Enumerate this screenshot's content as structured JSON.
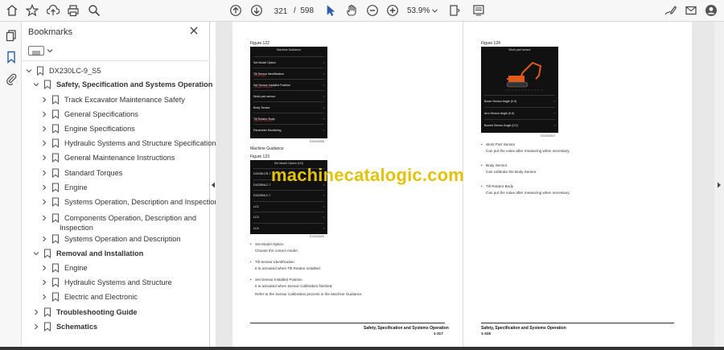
{
  "toolbar": {
    "page_current": "321",
    "page_separator": "/",
    "page_total": "598",
    "zoom": "53.9%",
    "icons": [
      "home-icon",
      "star-icon",
      "upload-icon",
      "print-icon",
      "zoom-search-icon",
      "page-up-icon",
      "page-down-icon",
      "select-cursor-icon",
      "hand-tool-icon",
      "zoom-out-icon",
      "zoom-in-icon",
      "fit-page-icon",
      "read-mode-icon",
      "sign-icon",
      "mail-icon",
      "account-icon"
    ]
  },
  "sidebar": {
    "title": "Bookmarks",
    "root": "DX230LC-9_S5",
    "items": [
      {
        "label": "Safety, Specification and Systems Operation",
        "level": 1,
        "expanded": true,
        "bold": true
      },
      {
        "label": "Track Excavator Maintenance Safety",
        "level": 2
      },
      {
        "label": "General Specifications",
        "level": 2
      },
      {
        "label": "Engine Specifications",
        "level": 2
      },
      {
        "label": "Hydraulic Systems and Structure Specifications",
        "level": 2
      },
      {
        "label": "General Maintenance Instructions",
        "level": 2
      },
      {
        "label": "Standard Torques",
        "level": 2
      },
      {
        "label": "Engine",
        "level": 2
      },
      {
        "label": "Systems Operation, Description and Inspection",
        "level": 2
      },
      {
        "label": "Components Operation, Description and",
        "label2": "Inspection",
        "level": 2
      },
      {
        "label": "Systems Operation and Description",
        "level": 2
      },
      {
        "label": "Removal and Installation",
        "level": 1,
        "expanded": true,
        "bold": true
      },
      {
        "label": "Engine",
        "level": 2
      },
      {
        "label": "Hydraulic Systems and Structure",
        "level": 2
      },
      {
        "label": "Electric and Electronic",
        "level": 2
      },
      {
        "label": "Troubleshooting Guide",
        "level": 1,
        "bold": true
      },
      {
        "label": "Schematics",
        "level": 1,
        "bold": true
      }
    ]
  },
  "doc": {
    "watermark": "machinecatalogic.com",
    "left": {
      "fig1_label": "Figure 122",
      "fig1_code": "EX2000808",
      "screen1": {
        "header": "Machine Guidance",
        "rows": [
          {
            "label": "Set Model Option",
            "sub": ""
          },
          {
            "label": "Tilt Sensor Identification",
            "sub": "Tilting Rotator"
          },
          {
            "label": "Set Sensor Installed Position",
            "sub": "Calibration Required"
          },
          {
            "label": "Work part sensor",
            "sub": ""
          },
          {
            "label": "Body Sensor",
            "sub": ""
          },
          {
            "label": "Tilt Rotator Body",
            "sub": "Calibration Required"
          },
          {
            "label": "Parameter Monitoring",
            "sub": ""
          }
        ]
      },
      "caption": "Machine Guidance",
      "fig2_label": "Figure 123",
      "fig2_code": "EX2000809",
      "screen2": {
        "header": "Set Model Option (1/2)",
        "rows": [
          {
            "label": "DX235LCR-7",
            "sub": ""
          },
          {
            "label": "DX235NLC-7",
            "sub": ""
          },
          {
            "label": "DX225NLC-7",
            "sub": ""
          },
          {
            "label": "LC2",
            "sub": ""
          },
          {
            "label": "LC3",
            "sub": ""
          },
          {
            "label": "LC4",
            "sub": ""
          }
        ]
      },
      "bullets": [
        {
          "title": "Set Model Option",
          "desc": "Choose the correct model."
        },
        {
          "title": "Tilt Sensor Identification",
          "desc": "It is activated when Tilt Rotator installed."
        },
        {
          "title": "Set Sensor Installed Position",
          "desc": "It is activated when Sensor Calibration finished."
        }
      ],
      "extra": "Refer to the Sensor Calibration process in the Machine Guidance.",
      "footer_title": "Safety, Specification and Systems Operation",
      "footer_num": "1-317"
    },
    "right": {
      "fig_label": "Figure 124",
      "fig_code": "EX2000810",
      "screen": {
        "header": "Work part sensor",
        "rows": [
          {
            "label": "Boom Sensor Angle (0.0)",
            "sub": ""
          },
          {
            "label": "Arm Sensor Angle (0.0)",
            "sub": ""
          },
          {
            "label": "Bucket Sensor Angle (0.0)",
            "sub": ""
          }
        ]
      },
      "bullets": [
        {
          "title": "Work Part Sensor",
          "desc": "Can put the value after measuring when necessary."
        },
        {
          "title": "Body Sensor",
          "desc": "Can calibrate the Body Sensor."
        },
        {
          "title": "Tilt Rotator Body",
          "desc": "Can put the value after measuring when necessary."
        }
      ],
      "footer_title": "Safety, Specification and Systems Operation",
      "footer_num": "1-318"
    }
  }
}
